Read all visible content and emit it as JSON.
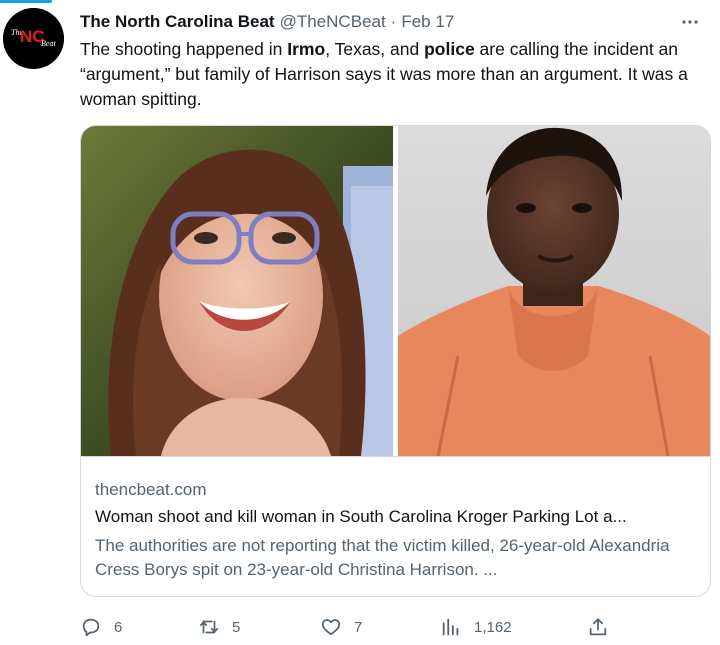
{
  "tweet": {
    "author_name": "The North Carolina Beat",
    "handle": "@TheNCBeat",
    "separator": "·",
    "date": "Feb 17",
    "avatar_logo_text": "NC",
    "text_parts": {
      "p1": "The shooting happened in ",
      "b1": "Irmo",
      "p2": ", Texas, and ",
      "b2": "police",
      "p3": " are calling the incident an “argument,” but family of Harrison says it was more than an argument. It was a woman spitting."
    }
  },
  "card": {
    "domain": "thencbeat.com",
    "title": "Woman shoot and kill woman in South Carolina Kroger Parking Lot a...",
    "description": "The authorities are not reporting that the victim killed, 26-year-old Alexandria Cress Borys spit on 23-year-old Christina Harrison. ..."
  },
  "actions": {
    "replies": "6",
    "reposts": "5",
    "likes": "7",
    "views": "1,162"
  },
  "icons": {
    "more": "more-horizontal-icon",
    "reply": "reply-icon",
    "repost": "repost-icon",
    "like": "heart-icon",
    "views": "views-icon",
    "share": "share-icon"
  },
  "colors": {
    "accent": "#1d9bf0",
    "text": "#0f1419",
    "secondary": "#536471",
    "border": "#cfd9de",
    "logo_red": "#e31b23"
  }
}
